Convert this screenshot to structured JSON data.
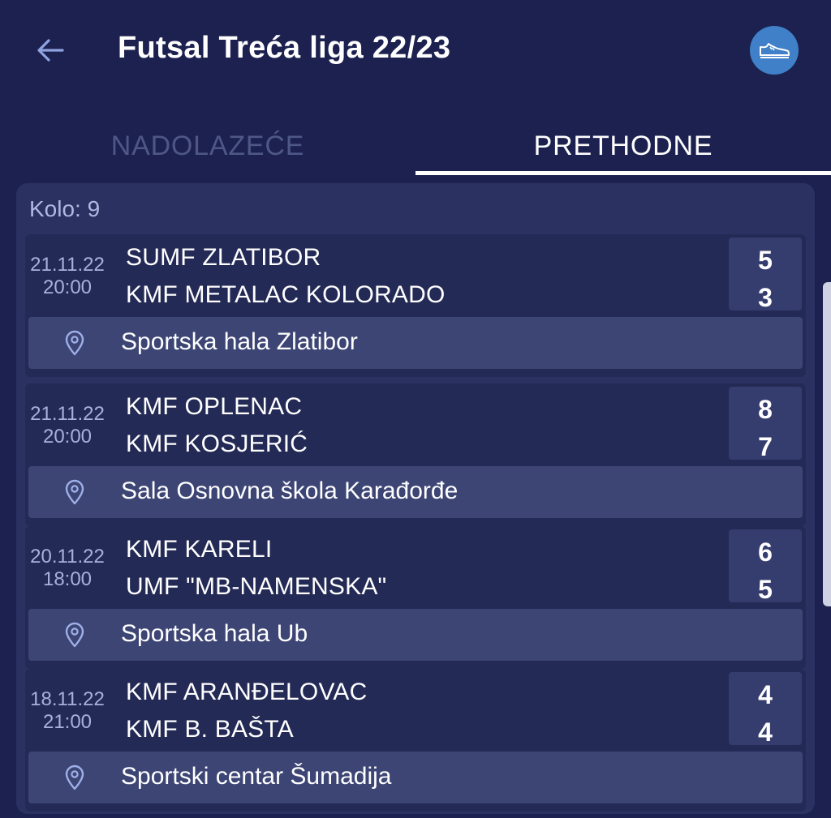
{
  "header": {
    "title": "Futsal Treća liga 22/23",
    "back_icon": "arrow-left-icon",
    "sport_icon": "sneaker-icon",
    "sport_button_color": "#3f80c8"
  },
  "tabs": [
    {
      "label": "NADOLAZEĆE",
      "active": false
    },
    {
      "label": "PRETHODNE",
      "active": true
    }
  ],
  "round": {
    "label": "Kolo: 9"
  },
  "matches": [
    {
      "date": "21.11.22",
      "time": "20:00",
      "home": "SUMF ZLATIBOR",
      "away": "KMF METALAC KOLORADO",
      "home_score": "5",
      "away_score": "3",
      "venue": "Sportska hala Zlatibor"
    },
    {
      "date": "21.11.22",
      "time": "20:00",
      "home": "KMF OPLENAC",
      "away": "KMF KOSJERIĆ",
      "home_score": "8",
      "away_score": "7",
      "venue": "Sala Osnovna škola Karađorđe"
    },
    {
      "date": "20.11.22",
      "time": "18:00",
      "home": "KMF KARELI",
      "away": "UMF \"MB-NAMENSKA\"",
      "home_score": "6",
      "away_score": "5",
      "venue": "Sportska hala Ub"
    },
    {
      "date": "18.11.22",
      "time": "21:00",
      "home": "KMF ARANĐELOVAC",
      "away": "KMF B. BAŠTA",
      "home_score": "4",
      "away_score": "4",
      "venue": "Sportski centar Šumadija"
    }
  ],
  "colors": {
    "background": "#1c2150",
    "card": "#2b3261",
    "match": "#242a56",
    "score_box": "#353d6e",
    "venue_row": "#3d4575",
    "inactive_tab": "#4f5787"
  }
}
